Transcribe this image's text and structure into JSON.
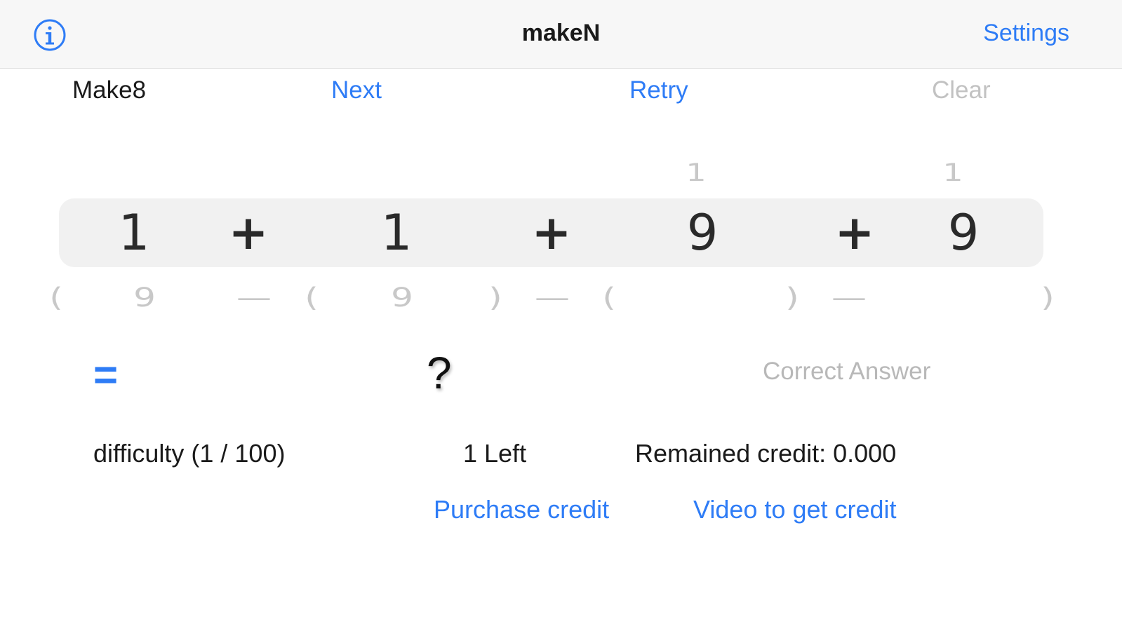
{
  "navbar": {
    "title": "makeN",
    "settings_label": "Settings",
    "info_icon": "info-circle-icon"
  },
  "toolbar": {
    "mode_label": "Make8",
    "next_label": "Next",
    "retry_label": "Retry",
    "clear_label": "Clear"
  },
  "picker": {
    "top_row": [
      "1",
      "1"
    ],
    "selected_row": [
      "1",
      "+",
      "1",
      "+",
      "9",
      "+",
      "9"
    ],
    "bottom_row": [
      "(",
      "9",
      "—",
      "(",
      "9",
      ")",
      "—",
      "(",
      ")",
      "—",
      ")"
    ]
  },
  "result": {
    "equals": "=",
    "answer": "?",
    "correct_answer_label": "Correct Answer"
  },
  "footer": {
    "difficulty_label": "difficulty (1 / 100)",
    "left_label": "1 Left",
    "credit_label": "Remained credit: 0.000",
    "purchase_label": "Purchase credit",
    "video_label": "Video to get credit"
  },
  "colors": {
    "accent": "#2e7cf6",
    "disabled": "#c2c2c2",
    "picker_band": "#f1f1f1"
  }
}
